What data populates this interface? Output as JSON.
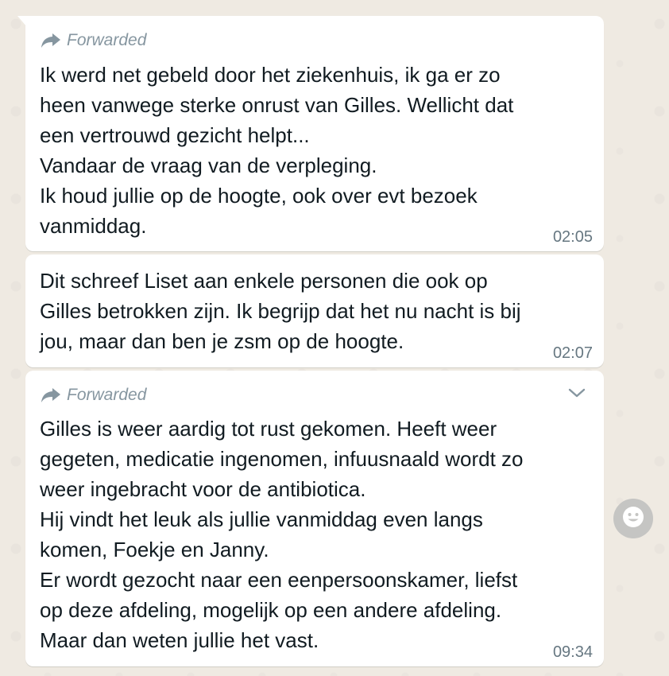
{
  "messages": [
    {
      "forwarded_label": "Forwarded",
      "lines": [
        "Ik werd net gebeld door het ziekenhuis, ik ga er zo",
        "heen vanwege sterke onrust van Gilles. Wellicht dat",
        "een vertrouwd gezicht helpt...",
        "Vandaar de vraag van de verpleging.",
        "Ik houd jullie op de hoogte, ook over evt bezoek",
        "vanmiddag."
      ],
      "time": "02:05"
    },
    {
      "lines": [
        "Dit schreef Liset aan enkele personen die ook op",
        "Gilles betrokken zijn. Ik begrijp dat het nu nacht is bij",
        "jou, maar dan ben je zsm op de hoogte."
      ],
      "time": "02:07"
    },
    {
      "forwarded_label": "Forwarded",
      "lines": [
        "Gilles is weer aardig tot rust gekomen. Heeft weer",
        "gegeten, medicatie ingenomen, infuusnaald wordt zo",
        "weer ingebracht voor de antibiotica.",
        "Hij vindt het leuk als jullie vanmiddag even langs",
        "komen, Foekje en Janny.",
        "Er wordt gezocht naar een eenpersoonskamer, liefst",
        "op deze afdeling, mogelijk op een andere afdeling.",
        "Maar dan weten jullie het vast."
      ],
      "time": "09:34"
    }
  ],
  "icons": {
    "forward": "forward-arrow-icon",
    "menu": "chevron-down-icon",
    "reaction": "smiley-icon"
  },
  "colors": {
    "background": "#efeae2",
    "bubble": "#ffffff",
    "meta_text": "#8696a0",
    "time_text": "#667781",
    "message_text": "#111b21"
  }
}
